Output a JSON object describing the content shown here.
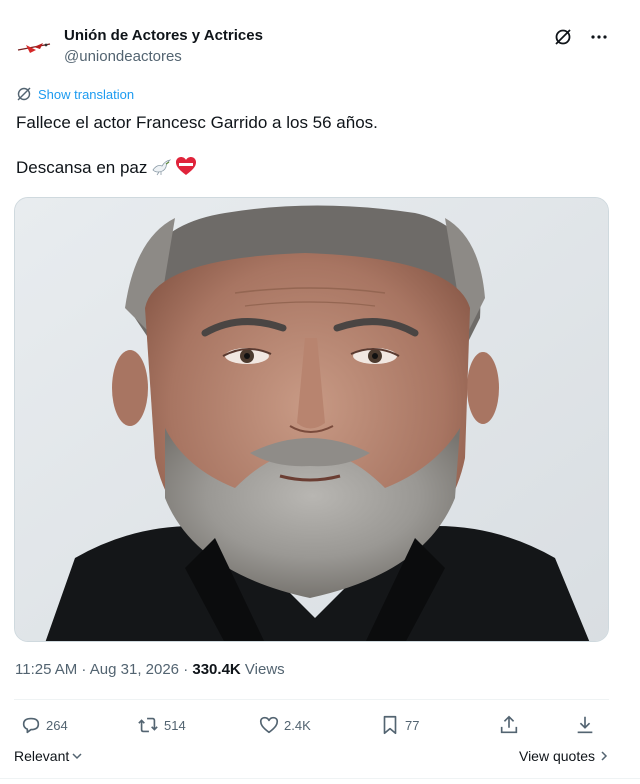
{
  "account": {
    "display_name": "Unión de Actores y Actrices",
    "handle": "@uniondeactores",
    "avatar_icon": "union-logo-icon"
  },
  "header_actions": {
    "grok_icon": "grok-icon",
    "more_icon": "more-icon"
  },
  "translate": {
    "label": "Show translation",
    "icon": "translate-icon",
    "color": "#1d9bf0"
  },
  "post": {
    "line1": "Fallece el actor Francesc Garrido a los 56 años.",
    "line2": "Descansa en paz",
    "emojis": [
      "dove-emoji",
      "heart-emoji"
    ]
  },
  "media": {
    "type": "portrait-photo"
  },
  "meta": {
    "time": "11:25 AM",
    "separator": " · ",
    "date": "Aug 31, 2026",
    "views_count": "330.4K",
    "views_label": "Views"
  },
  "actions": {
    "replies": "264",
    "reposts": "514",
    "likes": "2.4K",
    "bookmarks": "77"
  },
  "footer": {
    "relevant": "Relevant",
    "view_quotes": "View quotes"
  },
  "colors": {
    "text": "#0f1419",
    "secondary": "#536471",
    "accent": "#1d9bf0",
    "border": "#cfd9de"
  }
}
